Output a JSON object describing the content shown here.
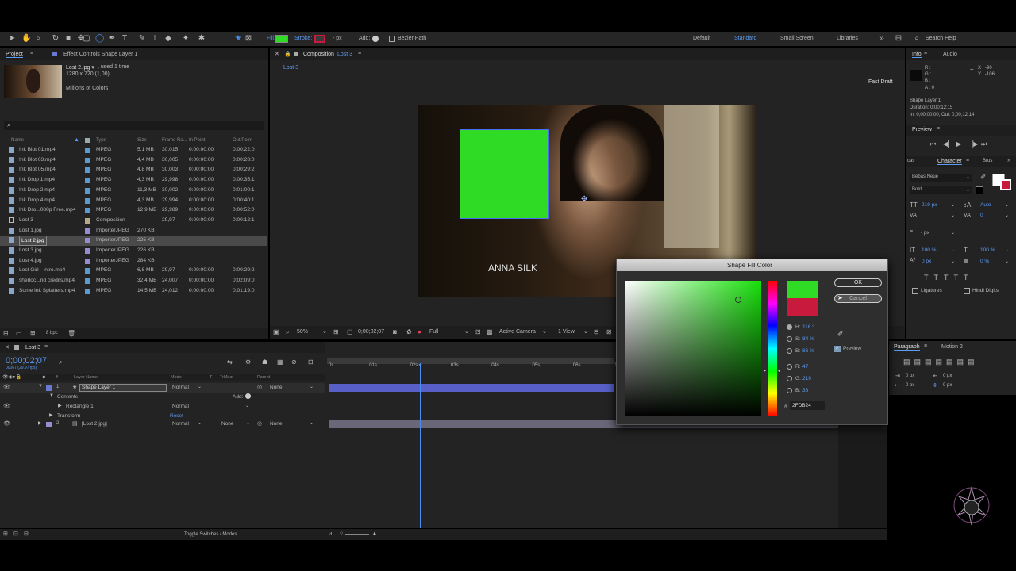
{
  "toolbar": {
    "fill_label": "Fill:",
    "stroke_label": "Stroke:",
    "stroke_px": "- px",
    "add_label": "Add:",
    "bezier_label": "Bezier Path",
    "workspaces": [
      "Default",
      "Standard",
      "Small Screen",
      "Libraries"
    ],
    "active_workspace": "Standard",
    "search_placeholder": "Search Help",
    "fill_color": "#2FDB24",
    "stroke_color": "#c81a3c"
  },
  "project": {
    "tab": "Project",
    "effect_tab": "Effect Controls Shape Layer 1",
    "thumb_name": "Lost 2.jpg ▾",
    "thumb_used": ", used 1 time",
    "thumb_dims": "1280 x 720 (1,00)",
    "thumb_colors": "Millions of Colors",
    "search_icon": "⌕",
    "columns": [
      "Name",
      "Type",
      "Size",
      "Frame Ra...",
      "In Point",
      "Out Point"
    ],
    "items": [
      {
        "name": "Ink Blot 01.mp4",
        "type": "MPEG",
        "size": "5,1 MB",
        "fps": "30,015",
        "in": "0:00:00:00",
        "out": "0:00:22:0",
        "kind": "file",
        "color": "#5b9bd0"
      },
      {
        "name": "Ink Blot 03.mp4",
        "type": "MPEG",
        "size": "4,4 MB",
        "fps": "30,005",
        "in": "0:00:00:00",
        "out": "0:00:28:0",
        "kind": "file",
        "color": "#5b9bd0"
      },
      {
        "name": "Ink Blot 05.mp4",
        "type": "MPEG",
        "size": "4,8 MB",
        "fps": "30,003",
        "in": "0:00:00:00",
        "out": "0:00:29:2",
        "kind": "file",
        "color": "#5b9bd0"
      },
      {
        "name": "Ink Drop 1.mp4",
        "type": "MPEG",
        "size": "4,3 MB",
        "fps": "29,998",
        "in": "0:00:00:00",
        "out": "0:00:35:1",
        "kind": "file",
        "color": "#5b9bd0"
      },
      {
        "name": "Ink Drop 2.mp4",
        "type": "MPEG",
        "size": "11,3 MB",
        "fps": "30,002",
        "in": "0:00:00:00",
        "out": "0:01:00:1",
        "kind": "file",
        "color": "#5b9bd0"
      },
      {
        "name": "Ink Drop 4.mp4",
        "type": "MPEG",
        "size": "4,3 MB",
        "fps": "29,994",
        "in": "0:00:00:00",
        "out": "0:00:40:1",
        "kind": "file",
        "color": "#5b9bd0"
      },
      {
        "name": "Ink Dro...080p Free.mp4",
        "type": "MPEG",
        "size": "12,9 MB",
        "fps": "29,989",
        "in": "0:00:00:00",
        "out": "0:00:52:0",
        "kind": "file",
        "color": "#5b9bd0"
      },
      {
        "name": "Lost 3",
        "type": "Composition",
        "size": "",
        "fps": "29,97",
        "in": "0:00:00:00",
        "out": "0:00:12:1",
        "kind": "comp",
        "color": "#b8a88a"
      },
      {
        "name": "Lost 1.jpg",
        "type": "ImporterJPEG",
        "size": "270 KB",
        "fps": "",
        "in": "",
        "out": "",
        "kind": "file",
        "color": "#9a8ad0"
      },
      {
        "name": "Lost 2.jpg",
        "type": "ImporterJPEG",
        "size": "225 KB",
        "fps": "",
        "in": "",
        "out": "",
        "kind": "file",
        "color": "#9a8ad0",
        "selected": true
      },
      {
        "name": "Lost 3.jpg",
        "type": "ImporterJPEG",
        "size": "226 KB",
        "fps": "",
        "in": "",
        "out": "",
        "kind": "file",
        "color": "#9a8ad0"
      },
      {
        "name": "Lost 4.jpg",
        "type": "ImporterJPEG",
        "size": "284 KB",
        "fps": "",
        "in": "",
        "out": "",
        "kind": "file",
        "color": "#9a8ad0"
      },
      {
        "name": "Lost Girl - Intro.mp4",
        "type": "MPEG",
        "size": "6,8 MB",
        "fps": "29,97",
        "in": "0:00:00:00",
        "out": "0:00:29:2",
        "kind": "file",
        "color": "#5b9bd0"
      },
      {
        "name": "sherloc...nd credits.mp4",
        "type": "MPEG",
        "size": "32,4 MB",
        "fps": "24,007",
        "in": "0:00:00:00",
        "out": "0:02:09:0",
        "kind": "file",
        "color": "#5b9bd0"
      },
      {
        "name": "Some Ink Splatters.mp4",
        "type": "MPEG",
        "size": "14,5 MB",
        "fps": "24,012",
        "in": "0:00:00:00",
        "out": "0:01:19:0",
        "kind": "file",
        "color": "#5b9bd0"
      }
    ],
    "bpc": "8 bpc"
  },
  "comp": {
    "tab": "Composition",
    "tab_name": "Lost 3",
    "subtab": "Lost 3",
    "fast_draft": "Fast Draft",
    "caption": "ANNA SILK",
    "zoom": "50%",
    "timecode": "0;00;02;07",
    "quality": "Full",
    "camera": "Active Camera",
    "views": "1 View"
  },
  "info": {
    "tab": "Info",
    "audio_tab": "Audio",
    "r": "R :",
    "g": "G :",
    "b": "B :",
    "a": "A : 0",
    "x": "X : -90",
    "y": "Y : -106",
    "layer": "Shape Layer 1",
    "duration": "Duration: 0;00;12;15",
    "inout": "In: 0;00;00;00, Out: 0;00;12;14"
  },
  "preview": {
    "title": "Preview"
  },
  "character": {
    "cas_tab": "cas",
    "tab": "Character",
    "brush_tab": "Brus",
    "font": "Bebas Neue",
    "style": "Bold",
    "size": "219 px",
    "leading": "Auto",
    "kerning": "",
    "tracking": "0",
    "stroke": "- px",
    "vscale": "100 %",
    "hscale": "100 %",
    "baseline": "0 px",
    "tsume": "0 %",
    "ligatures": "Ligatures",
    "hindi": "Hindi Digits"
  },
  "paragraph": {
    "tab": "Paragraph",
    "motion_tab": "Motion 2",
    "indent1": "0 px",
    "indent2": "0 px",
    "indent3": "0 px",
    "indent4": "0 px"
  },
  "dialog": {
    "title": "Shape Fill Color",
    "ok": "OK",
    "cancel": "Cancel",
    "h": "H:",
    "h_val": "116 °",
    "s": "S:",
    "s_val": "84 %",
    "b": "B:",
    "b_val": "86 %",
    "r": "R:",
    "r_val": "47",
    "g": "G:",
    "g_val": "219",
    "bb": "B:",
    "bb_val": "36",
    "hex_label": "#",
    "hex": "2FDB24",
    "preview": "Preview",
    "new_color": "#2FDB24",
    "old_color": "#c81a3c"
  },
  "timeline": {
    "tab": "Lost 3",
    "timecode": "0;00;02;07",
    "fps_note": "00067 (29.97 fps)",
    "columns": [
      "Layer Name",
      "Mode",
      "T",
      "TrkMat",
      "Parent"
    ],
    "ticks": [
      "0s",
      "01s",
      "02s",
      "03s",
      "04s",
      "05s",
      "06s",
      "07s"
    ],
    "layers": [
      {
        "num": "1",
        "name": "Shape Layer 1",
        "mode": "Normal",
        "parent": "None",
        "selected": true
      },
      {
        "num": "2",
        "name": "[Lost 2.jpg]",
        "mode": "Normal",
        "trkmat": "None",
        "parent": "None"
      }
    ],
    "contents": "Contents",
    "add": "Add:",
    "rect": "Rectangle 1",
    "rect_mode": "Normal",
    "transform": "Transform",
    "reset": "Reset",
    "toggle": "Toggle Switches / Modes"
  }
}
